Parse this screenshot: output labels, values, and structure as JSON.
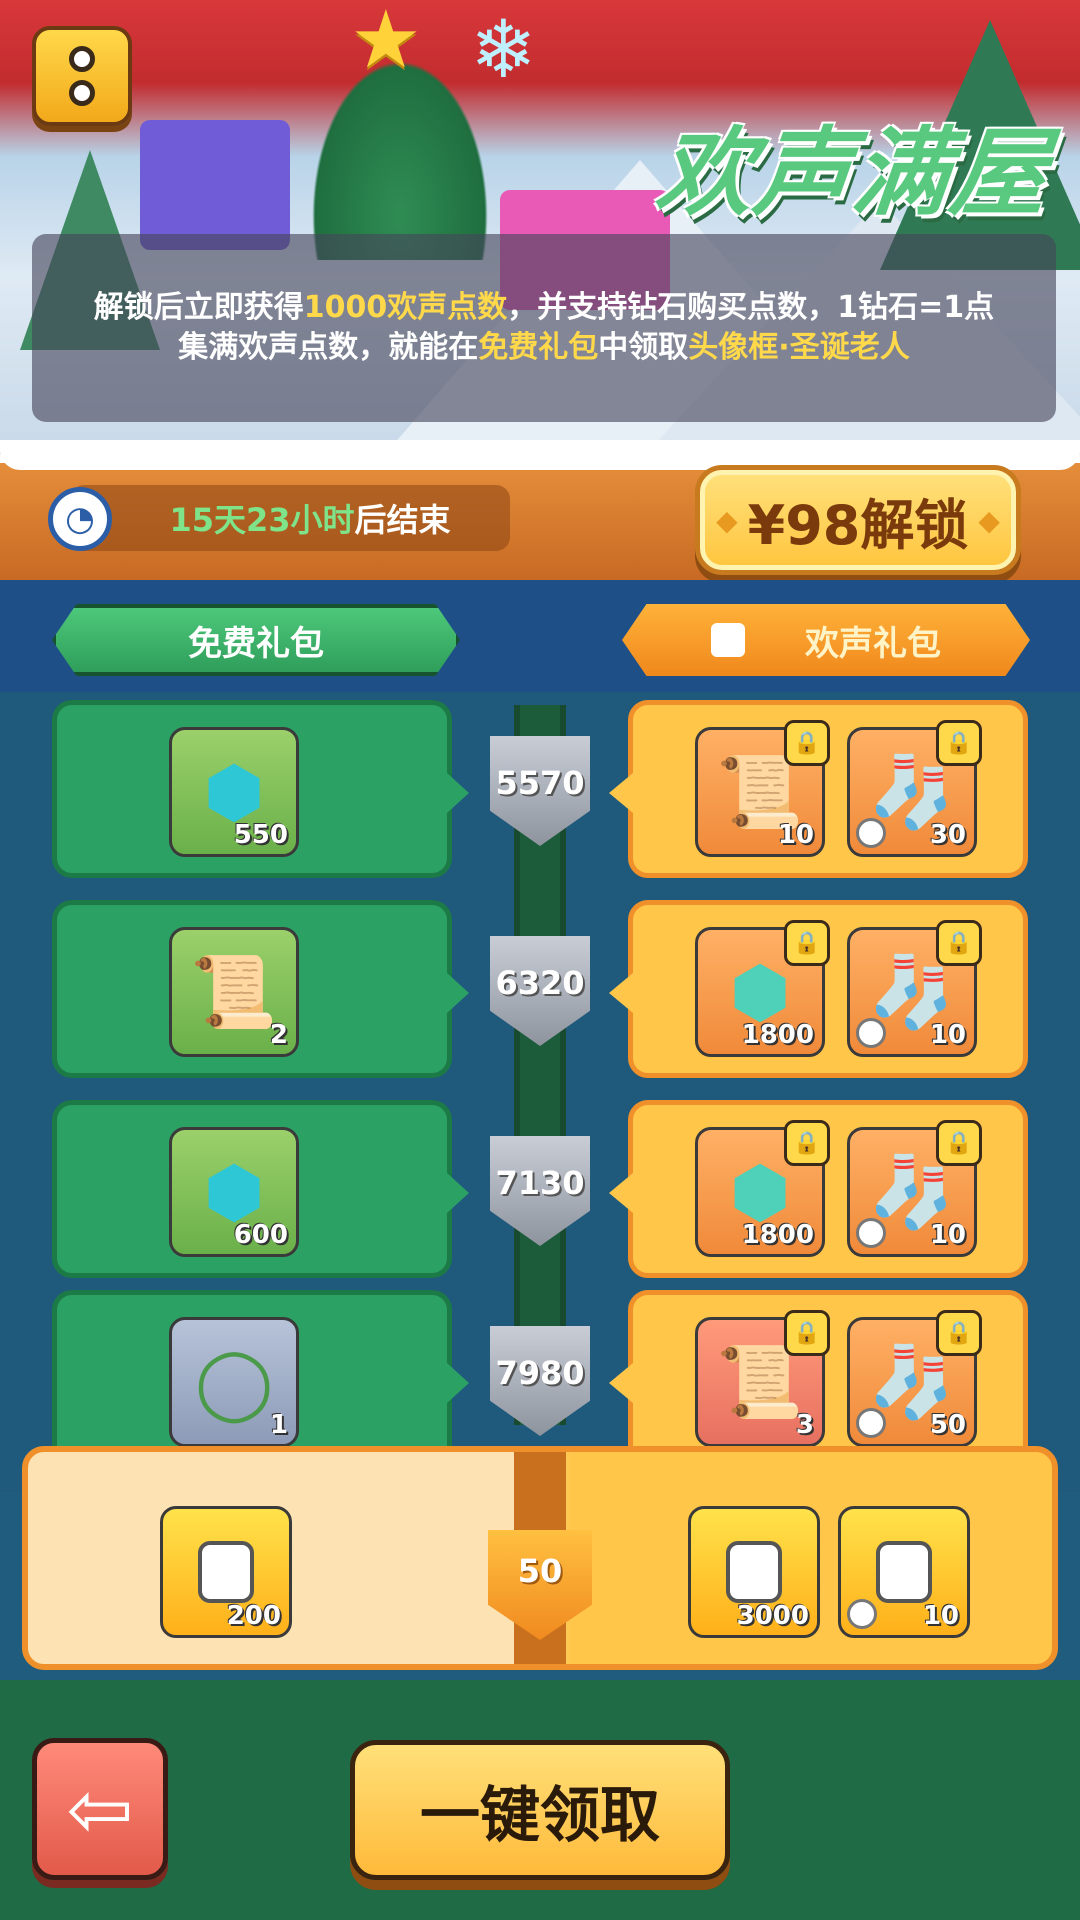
{
  "banner": {
    "title": "欢声满屋",
    "desc_line1": {
      "a": "解锁后立即获得",
      "b": "1000欢声点数",
      "c": "，并支持钻石购买点数，1钻石=1点"
    },
    "desc_line2": {
      "a": "集满欢声点数，就能在",
      "b": "免费礼包",
      "c": "中领取",
      "d": "头像框·圣诞老人"
    }
  },
  "timer": {
    "highlight": "15天23小时",
    "suffix": "后结束"
  },
  "unlock_button": {
    "label": "¥98解锁"
  },
  "tabs": {
    "free": "免费礼包",
    "joy": "欢声礼包"
  },
  "rows": [
    {
      "points": "5570",
      "free": {
        "icon": "gem-icon",
        "count": "550"
      },
      "joy": [
        {
          "icon": "scroll-icon",
          "count": "10"
        },
        {
          "icon": "stocking-icon",
          "count": "30"
        }
      ]
    },
    {
      "points": "6320",
      "free": {
        "icon": "scroll-icon",
        "count": "2"
      },
      "joy": [
        {
          "icon": "gem-icon",
          "count": "1800"
        },
        {
          "icon": "stocking-icon",
          "count": "10"
        }
      ]
    },
    {
      "points": "7130",
      "free": {
        "icon": "gem-icon",
        "count": "600"
      },
      "joy": [
        {
          "icon": "gem-icon",
          "count": "1800"
        },
        {
          "icon": "stocking-icon",
          "count": "10"
        }
      ]
    },
    {
      "points": "7980",
      "free": {
        "icon": "wreath-icon",
        "count": "1"
      },
      "joy": [
        {
          "icon": "scroll-icon",
          "count": "3"
        },
        {
          "icon": "stocking-icon",
          "count": "50"
        }
      ]
    }
  ],
  "summary": {
    "level": "50",
    "free_count": "200",
    "joy_counts": [
      "3000",
      "10"
    ]
  },
  "footer": {
    "claim_all": "一键领取"
  }
}
